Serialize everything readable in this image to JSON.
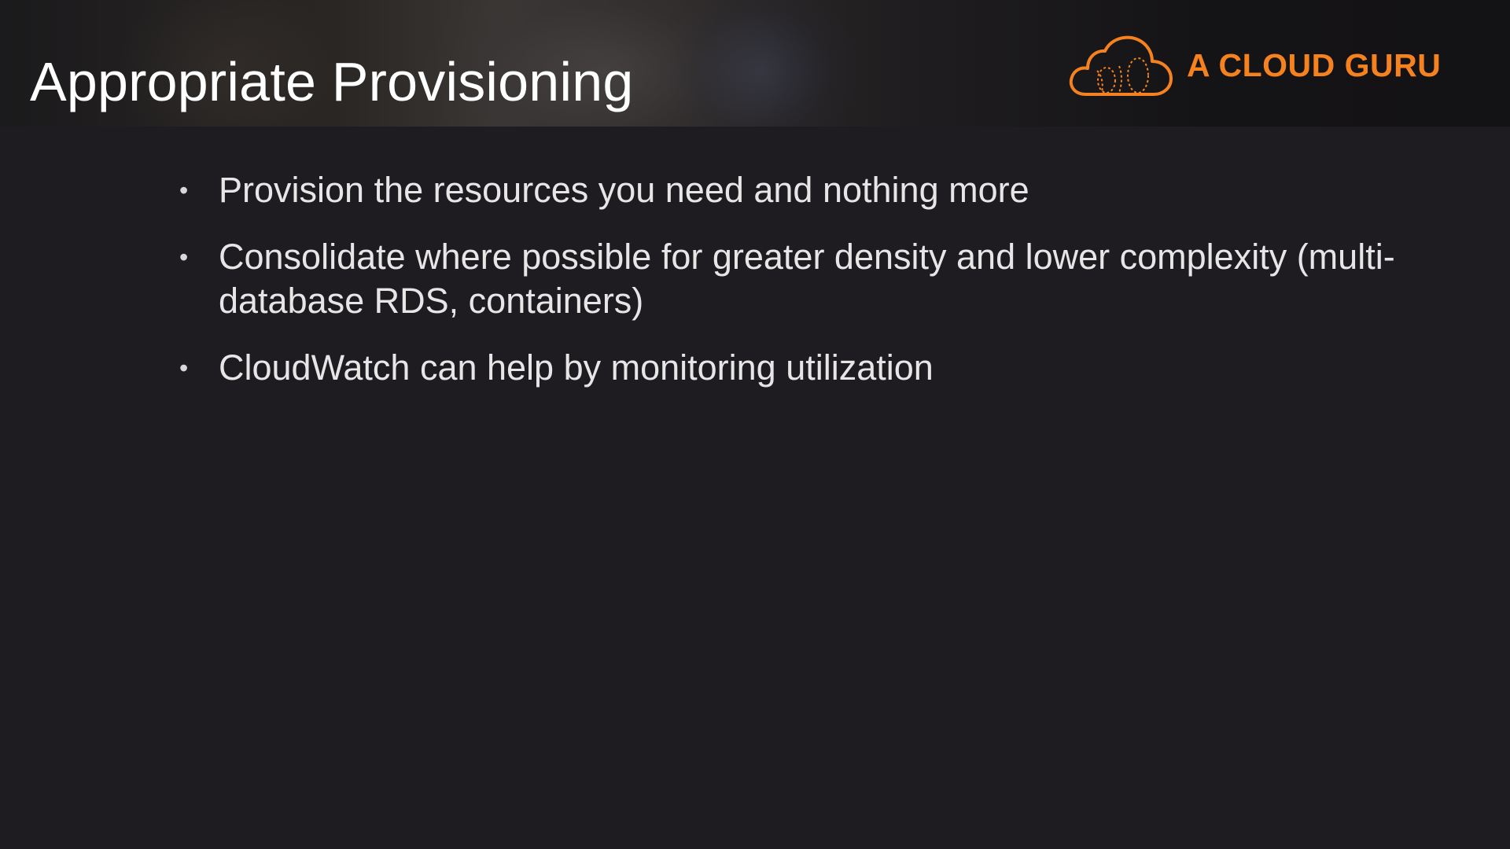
{
  "slide": {
    "title": "Appropriate Provisioning",
    "bullets": [
      "Provision the resources you need and nothing more",
      "Consolidate where possible for greater density and lower complexity (multi-database RDS, containers)",
      "CloudWatch can help by monitoring utilization"
    ]
  },
  "brand": {
    "name": "A CLOUD GURU",
    "logo_icon": "cloud-logo-icon",
    "accent_color": "#f5821f"
  },
  "colors": {
    "background": "#1e1c20",
    "title_text": "#ffffff",
    "body_text": "#e6e6e6"
  }
}
